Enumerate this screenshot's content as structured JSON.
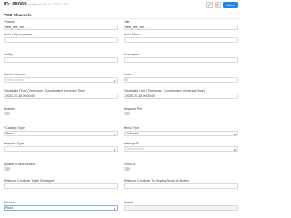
{
  "header": {
    "id": "ID: 68069",
    "meta": "Created at Oct 16, 2023 11:01",
    "save_label": "Save"
  },
  "section_title": "VOD Channels",
  "fields": {
    "name": {
      "label": "* Name",
      "value": "test_vod_vcc"
    },
    "title": {
      "label": "Title",
      "value": "test_vod_vcc"
    },
    "url_in_url_params": {
      "label": "Url in Url(url params",
      "value": ""
    },
    "url_in_menu": {
      "label": "Url in Menu",
      "value": ""
    },
    "tooltip": {
      "label": "Tooltip",
      "value": ""
    },
    "description": {
      "label": "Description",
      "value": ""
    },
    "parent_channel": {
      "label": "Parent Channel",
      "placeholder": "Select option"
    },
    "order": {
      "label": "Order",
      "value": "0"
    },
    "available_from": {
      "label": "* Available From (Timezone : Coordinated Universal Time)",
      "value": "2021-10-18 00:00:00"
    },
    "available_until": {
      "label": "* Available Until (Timezone : Coordinated Universal Time)",
      "value": "2025-10-18 00:00:00"
    },
    "enabled": {
      "label": "Enabled",
      "state": "off"
    },
    "requires_pin": {
      "label": "Requires Pin",
      "state": "off"
    },
    "catalog_type": {
      "label": "* Catalog Type",
      "value": "Menu"
    },
    "menu_type": {
      "label": "Menu Type",
      "value": "Unknown"
    },
    "deeplink_type": {
      "label": "Deeplink Type",
      "placeholder": ""
    },
    "settings_id": {
      "label": "Settings ID",
      "placeholder": "Select option"
    },
    "update_in_new_window": {
      "label": "Update in new window",
      "state": "off"
    },
    "show_all": {
      "label": "Show All",
      "state": "off"
    },
    "min_contents_displayed": {
      "label": "Minimum Contents To Be Displayed",
      "value": ""
    },
    "min_contents_show_all": {
      "label": "Minimum Contents To Display Show All Button",
      "value": ""
    },
    "source": {
      "label": "* Source",
      "value": "Root"
    },
    "owner": {
      "label": "Owner",
      "placeholder": ""
    }
  }
}
